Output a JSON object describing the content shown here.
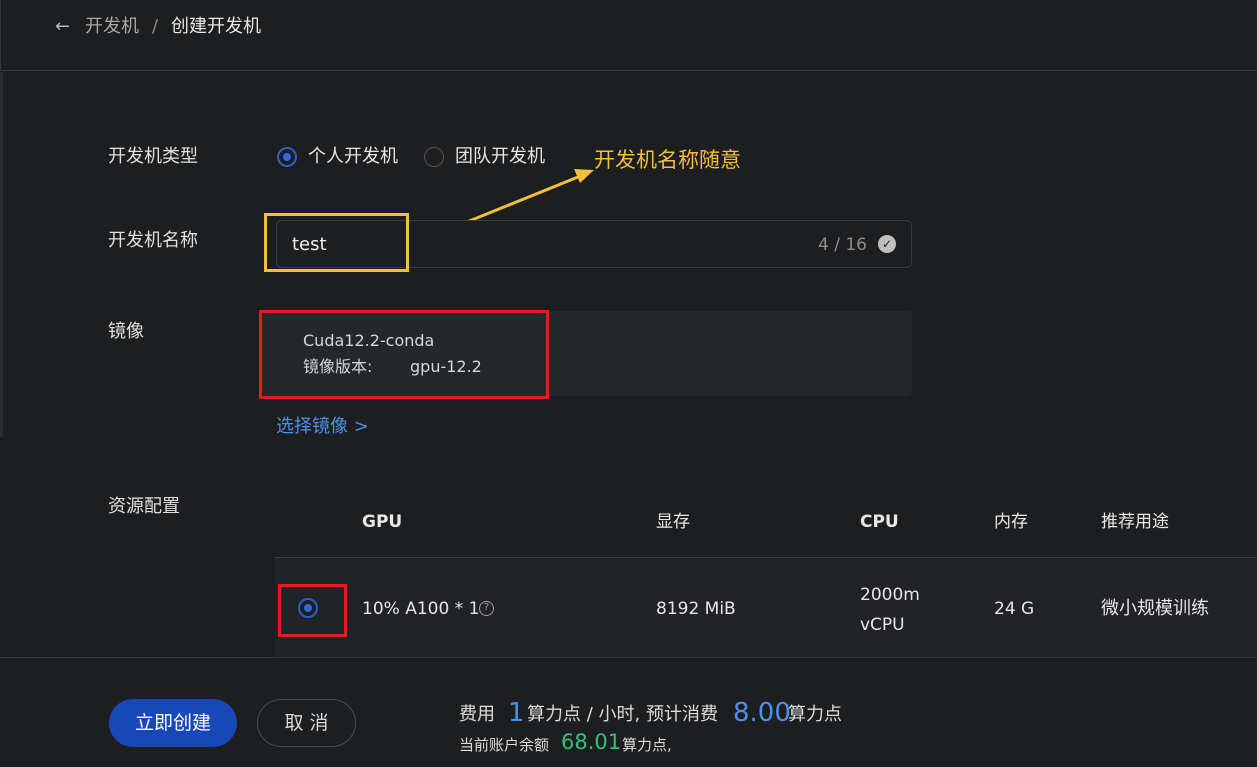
{
  "breadcrumb": {
    "back_icon": "arrow-left-icon",
    "parent": "开发机",
    "separator": "/",
    "current": "创建开发机"
  },
  "form": {
    "type_label": "开发机类型",
    "type_options": [
      {
        "label": "个人开发机",
        "selected": true
      },
      {
        "label": "团队开发机",
        "selected": false
      }
    ],
    "name_label": "开发机名称",
    "name_value": "test",
    "name_counter": "4 / 16",
    "image_label": "镜像",
    "image_name": "Cuda12.2-conda",
    "image_version_label": "镜像版本:",
    "image_version_value": "gpu-12.2",
    "select_image_link": "选择镜像 >",
    "resource_label": "资源配置"
  },
  "annotation": {
    "text": "开发机名称随意",
    "color": "#f3be3c"
  },
  "resource_table": {
    "headers": [
      "GPU",
      "显存",
      "CPU",
      "内存",
      "推荐用途"
    ],
    "rows": [
      {
        "selected": true,
        "gpu": "10% A100 * 1",
        "memory": "8192 MiB",
        "cpu_line1": "2000m",
        "cpu_line2": "vCPU",
        "ram": "24 G",
        "usage": "微小规模训练"
      }
    ]
  },
  "actions": {
    "create": "立即创建",
    "cancel": "取 消"
  },
  "cost": {
    "fee_prefix": "费用",
    "fee_value": "1",
    "fee_unit": "算力点 / 小时, 预计消费",
    "estimate_value": "8.00",
    "estimate_unit": "算力点",
    "balance_prefix": "当前账户余额",
    "balance_value": "68.01",
    "balance_unit": "算力点,"
  },
  "colors": {
    "accent": "#3468e0",
    "link": "#4b91ea",
    "balance": "#33c27a",
    "highlight_red": "#e11e1e",
    "background": "#1d1e20"
  }
}
